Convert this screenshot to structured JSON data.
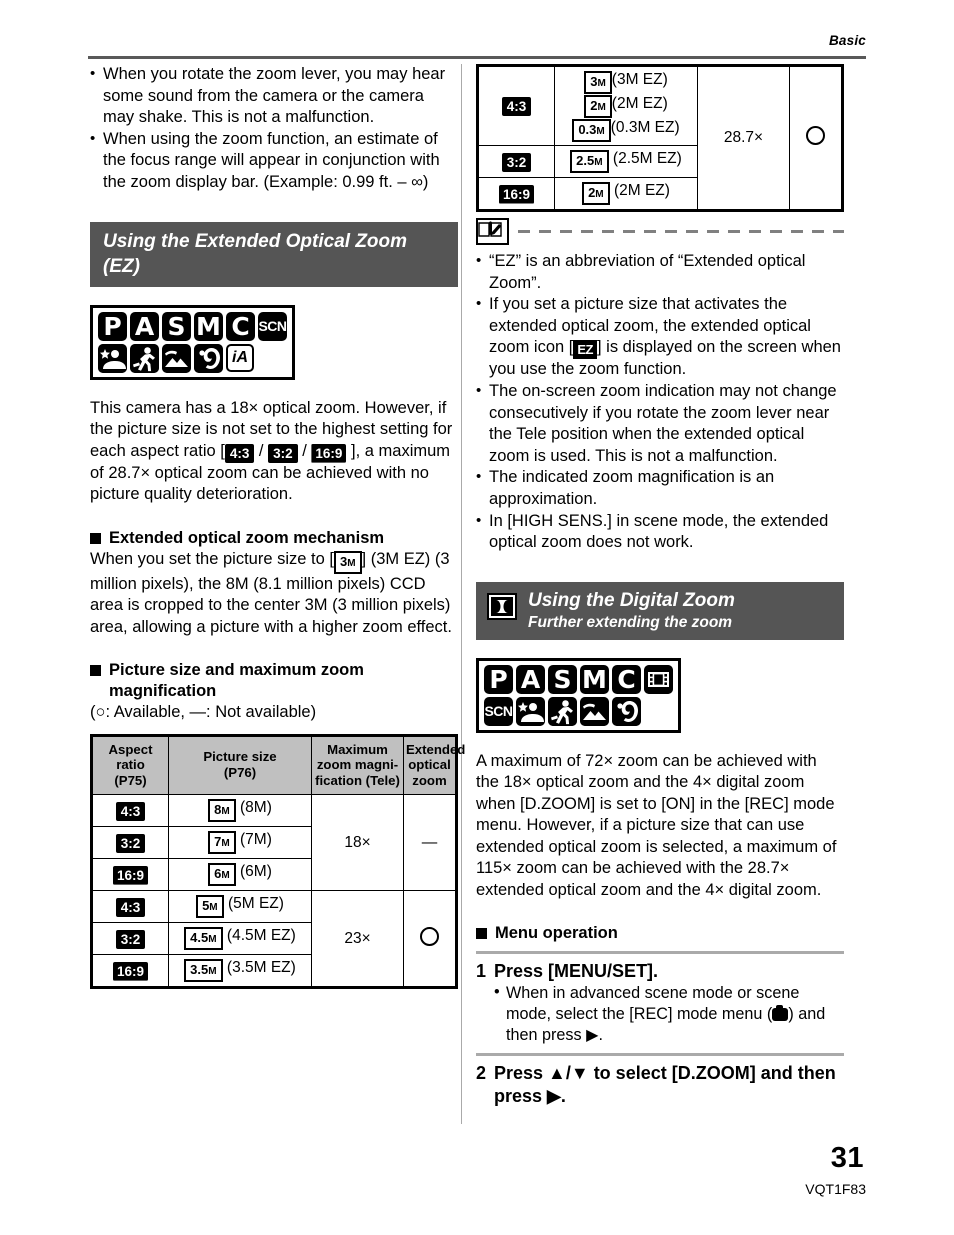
{
  "header": {
    "running_head": "Basic"
  },
  "footer": {
    "page_number": "31",
    "doc_id": "VQT1F83"
  },
  "left_column": {
    "intro_bullets": [
      "When you rotate the zoom lever, you may hear some sound from the camera or the camera may shake. This is not a malfunction.",
      "When using the zoom function, an estimate of the focus range will appear in conjunction with the zoom display bar. (Example: 0.99 ft. – ∞)"
    ],
    "section_banner": "Using the Extended Optical Zoom (EZ)",
    "mode_icons_row1": [
      "P",
      "A",
      "S",
      "M",
      "C",
      "SCN"
    ],
    "mode_icons_row2": [
      "night-portrait-icon",
      "sports-icon",
      "scenery-icon",
      "portrait-icon",
      "iA"
    ],
    "body_1a": "This camera has a 18× optical zoom. However, if the picture size is not set to the highest setting for each aspect ratio [",
    "body_1b": " / ",
    "body_1c": " / ",
    "body_1d": " ], a maximum of 28.7× optical zoom can be achieved with no picture quality deterioration.",
    "aspect_43": "4:3",
    "aspect_32": "3:2",
    "aspect_169": "16:9",
    "subhead_mechanism": "Extended optical zoom mechanism",
    "mechanism_text_a": "When you set the picture size to [",
    "mechanism_chip": "3",
    "mechanism_text_b": "] (3M EZ) (3 million pixels), the 8M (8.1 million pixels) CCD area is cropped to the center 3M (3 million pixels) area, allowing a picture with a higher zoom effect.",
    "subhead_picture_size": "Picture size and maximum zoom",
    "subhead_picture_size_cont": "magnification",
    "legend": "(○:  Available, —:  Not available)",
    "table": {
      "headers": [
        "Aspect ratio (P75)",
        "Picture size (P76)",
        "Maximum zoom magni-fication (Tele)",
        "Extended optical zoom"
      ],
      "header_lines": [
        [
          "Aspect",
          "ratio",
          "(P75)"
        ],
        [
          "Picture size",
          "(P76)"
        ],
        [
          "Maximum",
          "zoom magni-",
          "fication (Tele)"
        ],
        [
          "Extended",
          "optical",
          "zoom"
        ]
      ],
      "rows": [
        {
          "aspect": "4:3",
          "chip": "8",
          "label": "(8M)",
          "zoom": "18×",
          "ez": "—"
        },
        {
          "aspect": "3:2",
          "chip": "7",
          "label": "(7M)",
          "zoom": "",
          "ez": ""
        },
        {
          "aspect": "16:9",
          "chip": "6",
          "label": "(6M)",
          "zoom": "",
          "ez": ""
        },
        {
          "aspect": "4:3",
          "chip": "5",
          "label": "(5M EZ)",
          "zoom": "23×",
          "ez": "circle"
        },
        {
          "aspect": "3:2",
          "chip": "4.5",
          "label": "(4.5M EZ)",
          "zoom": "",
          "ez": ""
        },
        {
          "aspect": "16:9",
          "chip": "3.5",
          "label": "(3.5M EZ)",
          "zoom": "",
          "ez": ""
        }
      ],
      "group1_zoom": "18×",
      "group1_ez": "—",
      "group2_zoom": "23×"
    }
  },
  "right_column": {
    "table_cont": {
      "rows": [
        {
          "aspect": "4:3",
          "chips": [
            {
              "chip": "3",
              "label": "(3M EZ)"
            },
            {
              "chip": "2",
              "label": "(2M EZ)"
            },
            {
              "chip": "0.3",
              "label": "(0.3M EZ)"
            }
          ]
        },
        {
          "aspect": "3:2",
          "chips": [
            {
              "chip": "2.5",
              "label": "(2.5M EZ)"
            }
          ]
        },
        {
          "aspect": "16:9",
          "chips": [
            {
              "chip": "2",
              "label": "(2M EZ)"
            }
          ]
        }
      ],
      "zoom": "28.7×",
      "ez": "circle"
    },
    "note_bullets": [
      "“EZ” is an abbreviation of “Extended optical Zoom”.",
      "The on-screen zoom indication may not change consecutively if you rotate the zoom lever near the Tele position when the extended optical zoom is used. This is not a malfunction.",
      "The indicated zoom magnification is an approximation.",
      "In [HIGH SENS.] in scene mode, the extended optical zoom does not work."
    ],
    "note_bullet_ez_a": "If you set a picture size that activates the extended optical zoom, the extended optical zoom icon [",
    "note_bullet_ez_chip": "EZ",
    "note_bullet_ez_b": "] is displayed on the screen when you use the zoom function.",
    "section_banner_title": "Using the Digital Zoom",
    "section_banner_sub": "Further extending the zoom",
    "banner_icon": "digital-zoom-icon",
    "mode_icons_row1": [
      "P",
      "A",
      "S",
      "M",
      "C",
      "motion-picture-icon"
    ],
    "mode_icons_row2": [
      "SCN",
      "night-portrait-icon",
      "sports-icon",
      "scenery-icon",
      "portrait-icon"
    ],
    "body_digital": "A maximum of 72× zoom can be achieved with the 18× optical zoom and the 4× digital zoom when [D.ZOOM] is set to [ON] in the [REC] mode menu. However, if a picture size that can use extended optical zoom is selected, a maximum of 115× zoom can be achieved with the 28.7× extended optical zoom and the 4× digital zoom.",
    "subhead_menu": "Menu operation",
    "step1_num": "1",
    "step1_text": "Press [MENU/SET].",
    "step1_sub_a": "When in advanced scene mode or scene mode, select the [REC] mode menu (",
    "step1_sub_b": ") and then press ▶.",
    "step2_num": "2",
    "step2_text": "Press ▲/▼ to select [D.ZOOM] and then press ▶."
  },
  "colors": {
    "banner_bg": "#555555",
    "table_header_bg": "#c0c0c0",
    "rule": "#595959",
    "divider": "#aaaaaa"
  }
}
